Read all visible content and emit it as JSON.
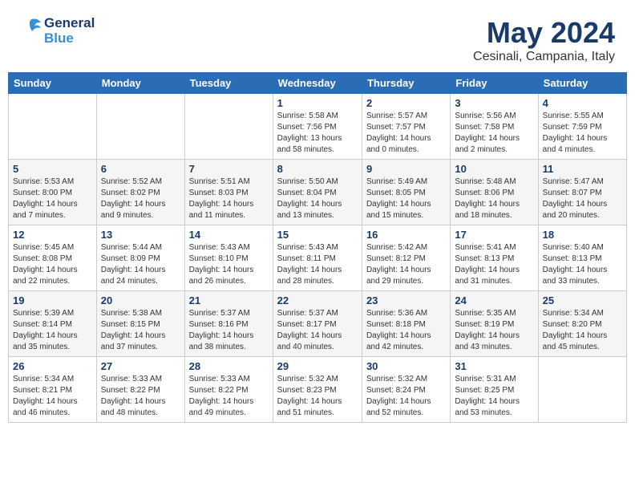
{
  "header": {
    "logo_general": "General",
    "logo_blue": "Blue",
    "month": "May 2024",
    "location": "Cesinali, Campania, Italy"
  },
  "weekdays": [
    "Sunday",
    "Monday",
    "Tuesday",
    "Wednesday",
    "Thursday",
    "Friday",
    "Saturday"
  ],
  "weeks": [
    [
      {
        "day": "",
        "info": ""
      },
      {
        "day": "",
        "info": ""
      },
      {
        "day": "",
        "info": ""
      },
      {
        "day": "1",
        "info": "Sunrise: 5:58 AM\nSunset: 7:56 PM\nDaylight: 13 hours\nand 58 minutes."
      },
      {
        "day": "2",
        "info": "Sunrise: 5:57 AM\nSunset: 7:57 PM\nDaylight: 14 hours\nand 0 minutes."
      },
      {
        "day": "3",
        "info": "Sunrise: 5:56 AM\nSunset: 7:58 PM\nDaylight: 14 hours\nand 2 minutes."
      },
      {
        "day": "4",
        "info": "Sunrise: 5:55 AM\nSunset: 7:59 PM\nDaylight: 14 hours\nand 4 minutes."
      }
    ],
    [
      {
        "day": "5",
        "info": "Sunrise: 5:53 AM\nSunset: 8:00 PM\nDaylight: 14 hours\nand 7 minutes."
      },
      {
        "day": "6",
        "info": "Sunrise: 5:52 AM\nSunset: 8:02 PM\nDaylight: 14 hours\nand 9 minutes."
      },
      {
        "day": "7",
        "info": "Sunrise: 5:51 AM\nSunset: 8:03 PM\nDaylight: 14 hours\nand 11 minutes."
      },
      {
        "day": "8",
        "info": "Sunrise: 5:50 AM\nSunset: 8:04 PM\nDaylight: 14 hours\nand 13 minutes."
      },
      {
        "day": "9",
        "info": "Sunrise: 5:49 AM\nSunset: 8:05 PM\nDaylight: 14 hours\nand 15 minutes."
      },
      {
        "day": "10",
        "info": "Sunrise: 5:48 AM\nSunset: 8:06 PM\nDaylight: 14 hours\nand 18 minutes."
      },
      {
        "day": "11",
        "info": "Sunrise: 5:47 AM\nSunset: 8:07 PM\nDaylight: 14 hours\nand 20 minutes."
      }
    ],
    [
      {
        "day": "12",
        "info": "Sunrise: 5:45 AM\nSunset: 8:08 PM\nDaylight: 14 hours\nand 22 minutes."
      },
      {
        "day": "13",
        "info": "Sunrise: 5:44 AM\nSunset: 8:09 PM\nDaylight: 14 hours\nand 24 minutes."
      },
      {
        "day": "14",
        "info": "Sunrise: 5:43 AM\nSunset: 8:10 PM\nDaylight: 14 hours\nand 26 minutes."
      },
      {
        "day": "15",
        "info": "Sunrise: 5:43 AM\nSunset: 8:11 PM\nDaylight: 14 hours\nand 28 minutes."
      },
      {
        "day": "16",
        "info": "Sunrise: 5:42 AM\nSunset: 8:12 PM\nDaylight: 14 hours\nand 29 minutes."
      },
      {
        "day": "17",
        "info": "Sunrise: 5:41 AM\nSunset: 8:13 PM\nDaylight: 14 hours\nand 31 minutes."
      },
      {
        "day": "18",
        "info": "Sunrise: 5:40 AM\nSunset: 8:13 PM\nDaylight: 14 hours\nand 33 minutes."
      }
    ],
    [
      {
        "day": "19",
        "info": "Sunrise: 5:39 AM\nSunset: 8:14 PM\nDaylight: 14 hours\nand 35 minutes."
      },
      {
        "day": "20",
        "info": "Sunrise: 5:38 AM\nSunset: 8:15 PM\nDaylight: 14 hours\nand 37 minutes."
      },
      {
        "day": "21",
        "info": "Sunrise: 5:37 AM\nSunset: 8:16 PM\nDaylight: 14 hours\nand 38 minutes."
      },
      {
        "day": "22",
        "info": "Sunrise: 5:37 AM\nSunset: 8:17 PM\nDaylight: 14 hours\nand 40 minutes."
      },
      {
        "day": "23",
        "info": "Sunrise: 5:36 AM\nSunset: 8:18 PM\nDaylight: 14 hours\nand 42 minutes."
      },
      {
        "day": "24",
        "info": "Sunrise: 5:35 AM\nSunset: 8:19 PM\nDaylight: 14 hours\nand 43 minutes."
      },
      {
        "day": "25",
        "info": "Sunrise: 5:34 AM\nSunset: 8:20 PM\nDaylight: 14 hours\nand 45 minutes."
      }
    ],
    [
      {
        "day": "26",
        "info": "Sunrise: 5:34 AM\nSunset: 8:21 PM\nDaylight: 14 hours\nand 46 minutes."
      },
      {
        "day": "27",
        "info": "Sunrise: 5:33 AM\nSunset: 8:22 PM\nDaylight: 14 hours\nand 48 minutes."
      },
      {
        "day": "28",
        "info": "Sunrise: 5:33 AM\nSunset: 8:22 PM\nDaylight: 14 hours\nand 49 minutes."
      },
      {
        "day": "29",
        "info": "Sunrise: 5:32 AM\nSunset: 8:23 PM\nDaylight: 14 hours\nand 51 minutes."
      },
      {
        "day": "30",
        "info": "Sunrise: 5:32 AM\nSunset: 8:24 PM\nDaylight: 14 hours\nand 52 minutes."
      },
      {
        "day": "31",
        "info": "Sunrise: 5:31 AM\nSunset: 8:25 PM\nDaylight: 14 hours\nand 53 minutes."
      },
      {
        "day": "",
        "info": ""
      }
    ]
  ]
}
